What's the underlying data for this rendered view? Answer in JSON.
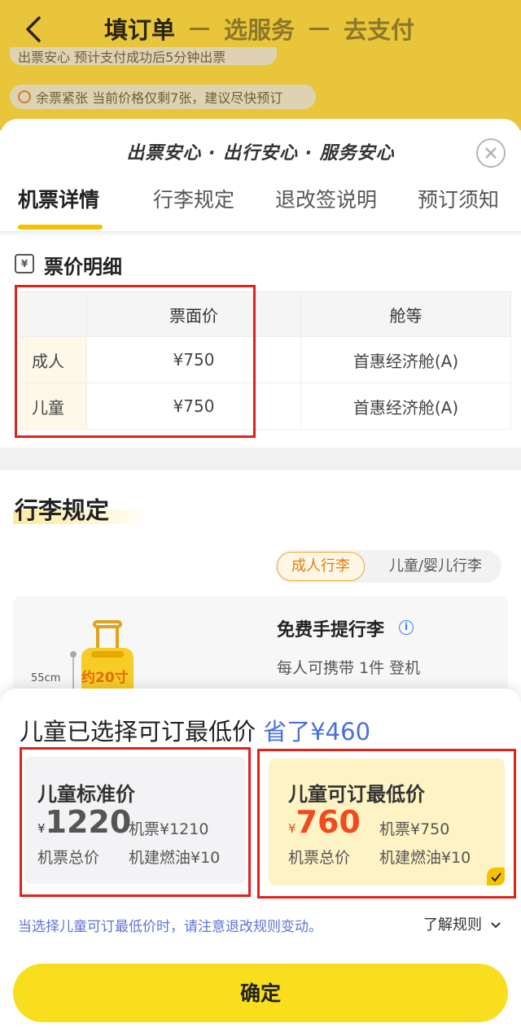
{
  "header": {
    "steps": [
      "填订单",
      "选服务",
      "去支付"
    ],
    "notice_1": "出票安心  预计支付成功后5分钟出票",
    "notice_2": "余票紧张  当前价格仅剩7张，建议尽快预订"
  },
  "sheet": {
    "title": "出票安心 · 出行安心 · 服务安心",
    "tabs": [
      "机票详情",
      "行李规定",
      "退改签说明",
      "预订须知"
    ],
    "active_tab": "机票详情"
  },
  "price_detail": {
    "section_title": "票价明细",
    "icon_glyph": "¥",
    "columns": [
      "",
      "票面价",
      "舱等"
    ],
    "rows": [
      {
        "type": "成人",
        "price": "¥750",
        "cabin": "首惠经济舱(A)"
      },
      {
        "type": "儿童",
        "price": "¥750",
        "cabin": "首惠经济舱(A)"
      }
    ]
  },
  "baggage": {
    "section_title": "行李规定",
    "toggle": [
      "成人行李",
      "儿童/婴儿行李"
    ],
    "dimension_label": "55cm",
    "badge_text": "约20寸",
    "item_title": "免费手提行李",
    "item_desc": "每人可携带 1件 登机"
  },
  "dialog": {
    "title": "儿童已选择可订最低价",
    "saved": "省了¥460",
    "options": [
      {
        "name": "儿童标准价",
        "currency": "¥",
        "price": "1220",
        "total_label": "机票总价",
        "ticket": "机票¥1210",
        "tax": "机建燃油¥10",
        "selected": false
      },
      {
        "name": "儿童可订最低价",
        "currency": "¥",
        "price": "760",
        "total_label": "机票总价",
        "ticket": "机票¥750",
        "tax": "机建燃油¥10",
        "selected": true
      }
    ],
    "note": "当选择儿童可订最低价时，请注意退改规则变动。",
    "rules_link": "了解规则",
    "confirm": "确定"
  },
  "colors": {
    "brand_yellow": "#f8de1c",
    "highlight_red": "#e3211b",
    "price_orange": "#ef4b1f",
    "link_blue": "#4a6fdc"
  }
}
